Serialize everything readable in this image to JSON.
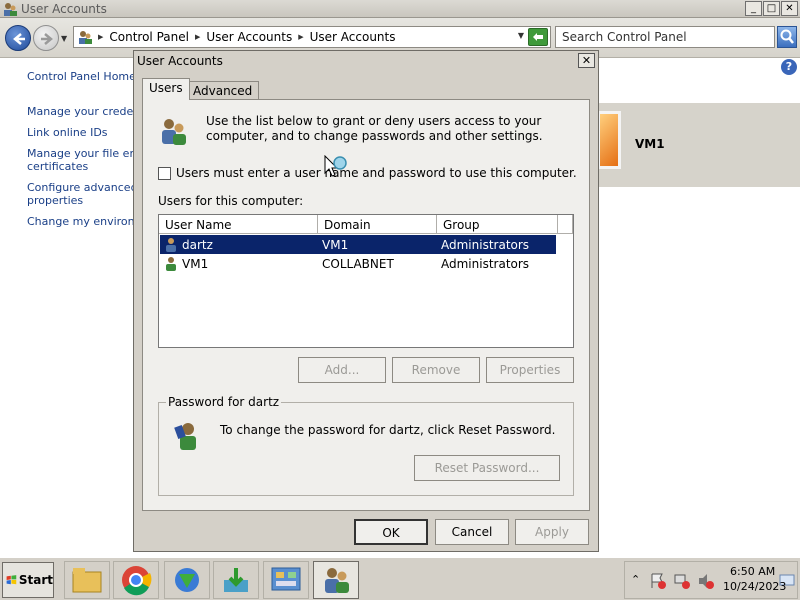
{
  "window": {
    "title": "User Accounts",
    "minimize": "_",
    "maximize": "□",
    "close": "✕"
  },
  "address": {
    "crumbs": [
      "Control Panel",
      "User Accounts",
      "User Accounts"
    ],
    "search_placeholder": "Search Control Panel"
  },
  "left_nav": {
    "items": [
      "Control Panel Home",
      "Manage your credentials",
      "Link online IDs",
      "Manage your file encryption",
      "certificates",
      "Configure advanced user",
      "properties",
      "Change my environment"
    ]
  },
  "help": "?",
  "account_panel": {
    "name": "VM1"
  },
  "dialog": {
    "title": "User Accounts",
    "close": "✕",
    "tabs": [
      "Users",
      "Advanced"
    ],
    "description": "Use the list below to grant or deny users access to your computer, and to change passwords and other settings.",
    "checkbox_label": "Users must enter a user name and password to use this computer.",
    "users_label": "Users for this computer:",
    "columns": [
      "User Name",
      "Domain",
      "Group"
    ],
    "rows": [
      {
        "user": "dartz",
        "domain": "VM1",
        "group": "Administrators",
        "selected": true
      },
      {
        "user": "VM1",
        "domain": "COLLABNET",
        "group": "Administrators",
        "selected": false
      }
    ],
    "buttons": {
      "add": "Add...",
      "remove": "Remove",
      "properties": "Properties"
    },
    "password_group": {
      "legend": "Password for dartz",
      "text": "To change the password for dartz, click Reset Password.",
      "reset": "Reset Password..."
    },
    "footer": {
      "ok": "OK",
      "cancel": "Cancel",
      "apply": "Apply"
    }
  },
  "taskbar": {
    "start": "Start",
    "apps": [
      "file-explorer",
      "chrome",
      "download-manager",
      "installer",
      "control-panel",
      "user-accounts"
    ],
    "time": "6:50 AM",
    "date": "10/24/2023"
  },
  "colors": {
    "selection": "#0a246a",
    "link": "#1a3f87",
    "dialog_face": "#d4d0c8"
  }
}
